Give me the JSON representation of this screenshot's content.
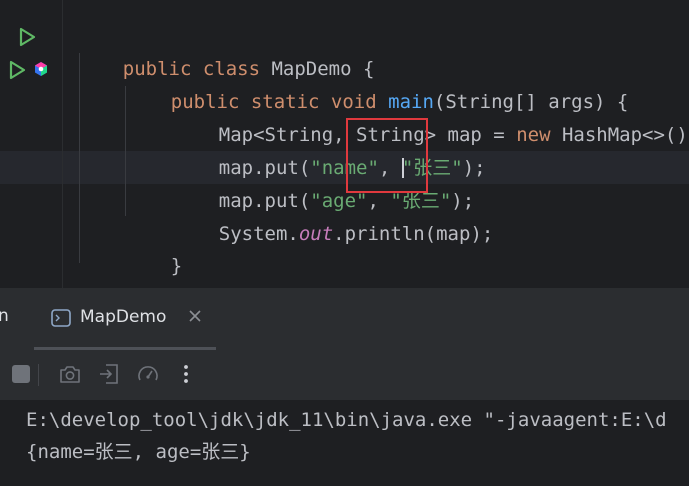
{
  "editor": {
    "lines": [
      {
        "parts": [
          {
            "t": "public ",
            "c": "kw"
          },
          {
            "t": "class ",
            "c": "kw"
          },
          {
            "t": "MapDemo {",
            "c": ""
          }
        ]
      },
      {
        "parts": [
          {
            "t": "public ",
            "c": "kw"
          },
          {
            "t": "static ",
            "c": "kw"
          },
          {
            "t": "void ",
            "c": "kw"
          },
          {
            "t": "main",
            "c": "fn"
          },
          {
            "t": "(String[] args) {",
            "c": ""
          }
        ]
      },
      {
        "parts": [
          {
            "t": "Map<String, String> map = ",
            "c": ""
          },
          {
            "t": "new ",
            "c": "kw"
          },
          {
            "t": "HashMap<>();",
            "c": ""
          }
        ]
      },
      {
        "parts": [
          {
            "t": "map.put(",
            "c": ""
          },
          {
            "t": "\"name\"",
            "c": "str"
          },
          {
            "t": ", ",
            "c": ""
          },
          {
            "t": "\"张三\"",
            "c": "str"
          },
          {
            "t": ");",
            "c": ""
          }
        ]
      },
      {
        "parts": [
          {
            "t": "map.put(",
            "c": ""
          },
          {
            "t": "\"age\"",
            "c": "str"
          },
          {
            "t": ", ",
            "c": ""
          },
          {
            "t": "\"张三\"",
            "c": "str"
          },
          {
            "t": ");",
            "c": ""
          }
        ]
      },
      {
        "parts": [
          {
            "t": "System.",
            "c": ""
          },
          {
            "t": "out",
            "c": "field"
          },
          {
            "t": ".println(map);",
            "c": ""
          }
        ]
      },
      {
        "parts": [
          {
            "t": "}",
            "c": ""
          }
        ]
      },
      {
        "parts": [
          {
            "t": "}",
            "c": ""
          }
        ]
      }
    ],
    "gutter_icons": [
      "run-icon",
      "run-icon",
      "bean-icon"
    ]
  },
  "tool_window": {
    "partial_tab_label": "n",
    "active_tab_label": "MapDemo",
    "active_tab_icon": "console-icon"
  },
  "toolbar": {
    "icons": [
      "stop-icon",
      "camera-icon",
      "import-icon",
      "gauge-icon",
      "more-icon"
    ]
  },
  "console": {
    "lines": [
      "E:\\develop_tool\\jdk\\jdk_11\\bin\\java.exe \"-javaagent:E:\\d",
      "{name=张三, age=张三}"
    ]
  },
  "colors": {
    "highlight": "#e0393e",
    "run_green": "#5fb865",
    "keyword": "#cf8e6d",
    "string": "#6aab73"
  }
}
